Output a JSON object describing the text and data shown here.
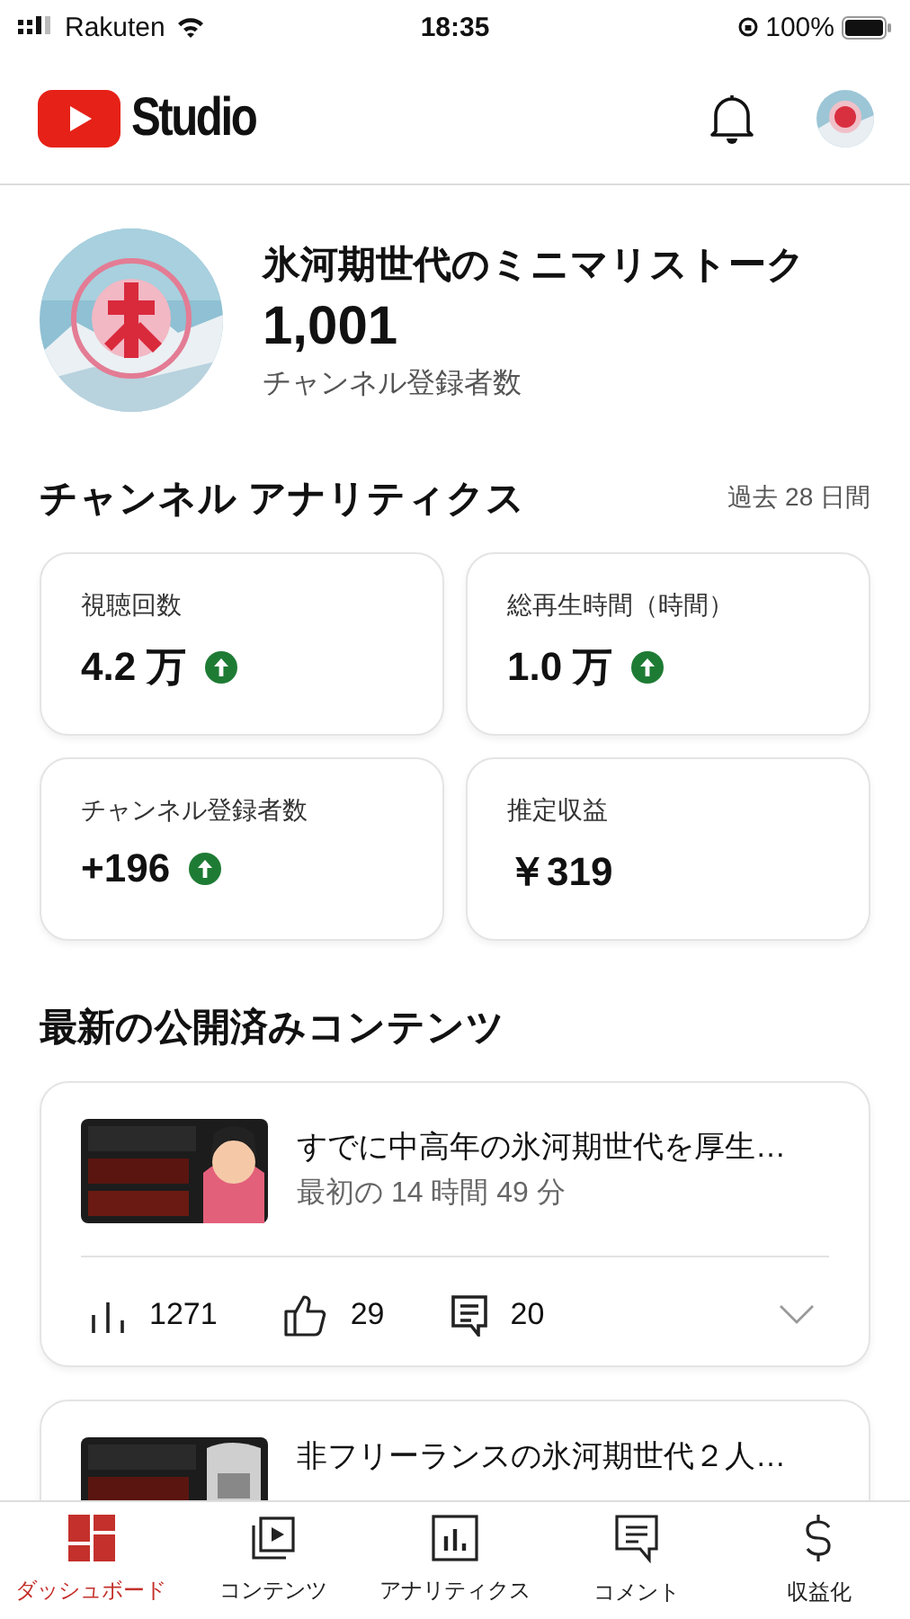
{
  "status_bar": {
    "carrier": "Rakuten",
    "time": "18:35",
    "battery": "100%"
  },
  "header": {
    "title": "Studio"
  },
  "channel": {
    "name": "氷河期世代のミニマリストーク",
    "subscribers": "1,001",
    "subscribers_label": "チャンネル登録者数"
  },
  "analytics": {
    "title": "チャンネル アナリティクス",
    "period": "過去 28 日間",
    "metrics": [
      {
        "label": "視聴回数",
        "value": "4.2 万",
        "trending_up": true
      },
      {
        "label": "総再生時間（時間）",
        "value": "1.0 万",
        "trending_up": true
      },
      {
        "label": "チャンネル登録者数",
        "value": "+196",
        "trending_up": true
      },
      {
        "label": "推定収益",
        "value": "￥319",
        "trending_up": false
      }
    ]
  },
  "latest": {
    "title": "最新の公開済みコンテンツ",
    "items": [
      {
        "title": "すでに中高年の氷河期世代を厚生…",
        "subtitle": "最初の 14 時間 49 分",
        "stats": [
          "1271",
          "29",
          "20"
        ]
      },
      {
        "title": "非フリーランスの氷河期世代２人…"
      }
    ]
  },
  "nav": [
    {
      "label": "ダッシュボード",
      "selected": true
    },
    {
      "label": "コンテンツ",
      "selected": false
    },
    {
      "label": "アナリティクス",
      "selected": false
    },
    {
      "label": "コメント",
      "selected": false
    },
    {
      "label": "収益化",
      "selected": false
    }
  ]
}
